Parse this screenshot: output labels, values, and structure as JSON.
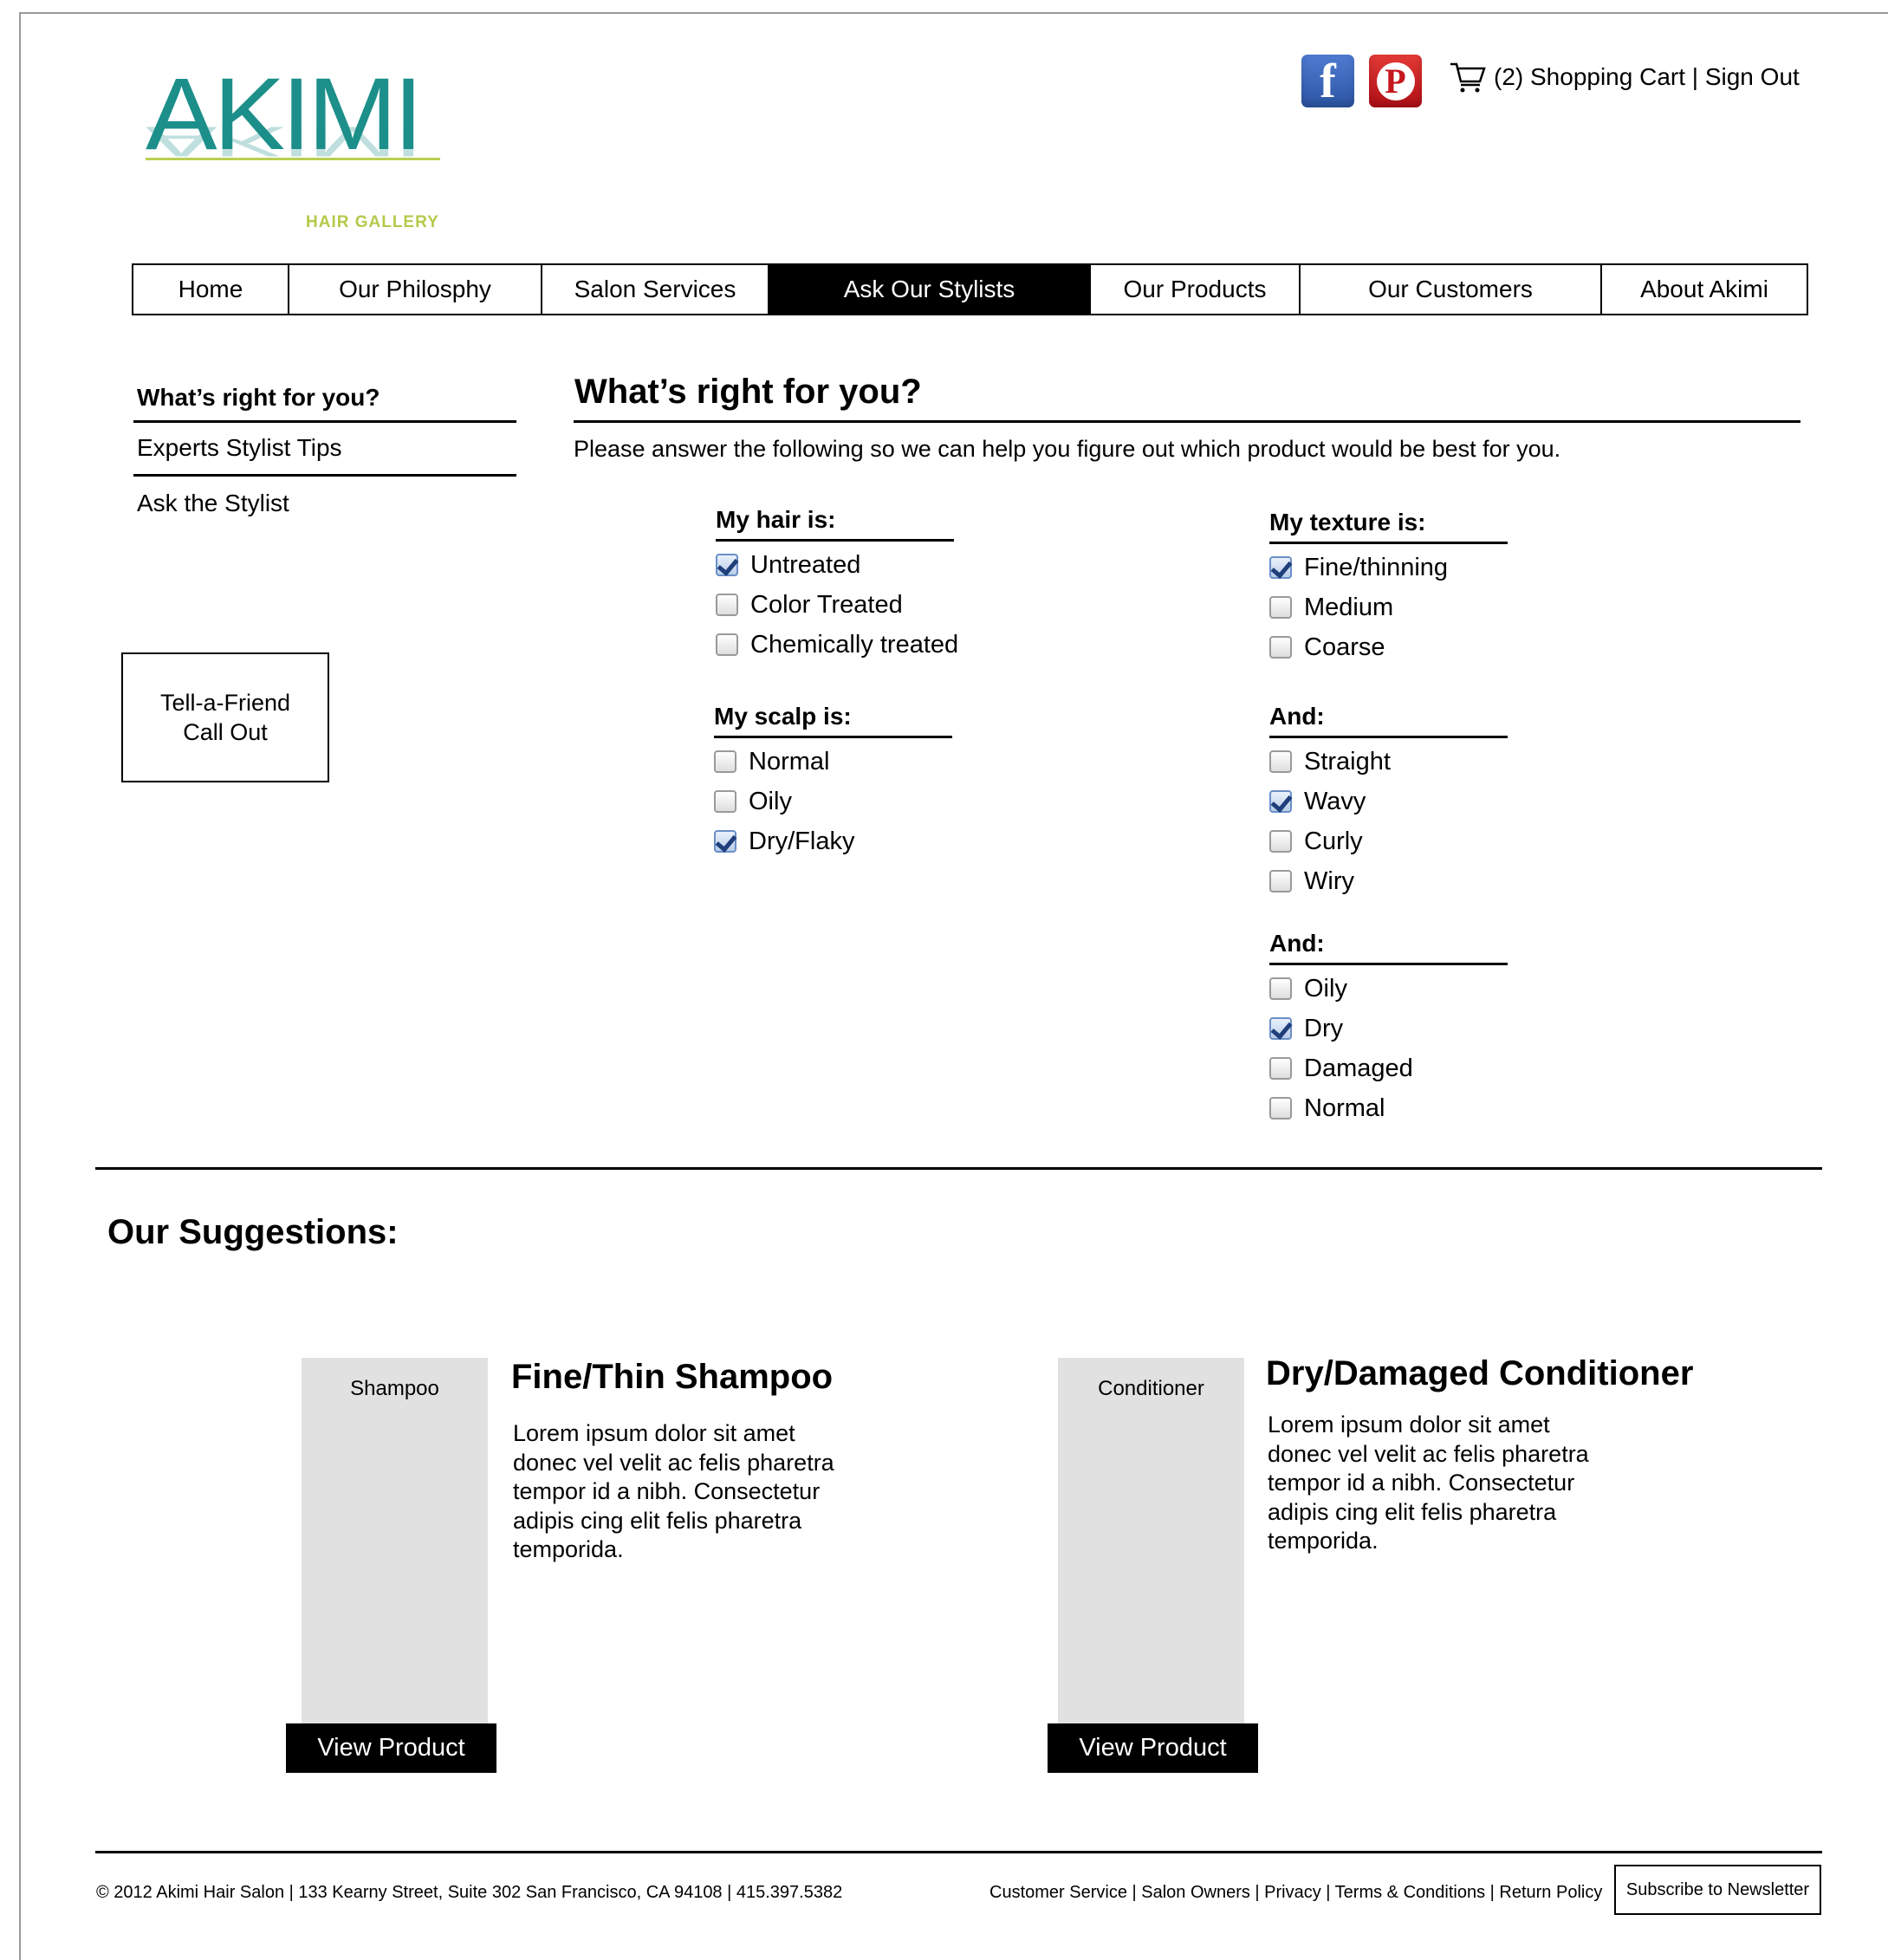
{
  "brand": {
    "logo_text": "AKIMI",
    "logo_sub": "HAIR GALLERY",
    "teal": "#1c8f8a",
    "lime": "#b9cf53"
  },
  "header": {
    "social": [
      {
        "name": "facebook-icon",
        "glyph": "f"
      },
      {
        "name": "pinterest-icon",
        "glyph": "P"
      }
    ],
    "cart_label": "(2) Shopping Cart | Sign Out"
  },
  "nav": [
    {
      "label": "Home",
      "active": false
    },
    {
      "label": "Our Philosphy",
      "active": false
    },
    {
      "label": "Salon Services",
      "active": false
    },
    {
      "label": "Ask Our Stylists",
      "active": true
    },
    {
      "label": "Our Products",
      "active": false
    },
    {
      "label": "Our Customers",
      "active": false
    },
    {
      "label": "About Akimi",
      "active": false
    }
  ],
  "sidebar": {
    "items": [
      "What’s right for you?",
      "Experts Stylist Tips",
      "Ask the Stylist"
    ],
    "callout": [
      "Tell-a-Friend",
      "Call Out"
    ]
  },
  "main": {
    "title": "What’s right for you?",
    "intro": "Please answer the following so we can help you figure out which product would be best for you.",
    "groups": {
      "hair": {
        "title": "My hair is:",
        "options": [
          {
            "label": "Untreated",
            "checked": true
          },
          {
            "label": "Color Treated",
            "checked": false
          },
          {
            "label": "Chemically treated",
            "checked": false
          }
        ]
      },
      "scalp": {
        "title": "My scalp is:",
        "options": [
          {
            "label": "Normal",
            "checked": false
          },
          {
            "label": "Oily",
            "checked": false
          },
          {
            "label": "Dry/Flaky",
            "checked": true
          }
        ]
      },
      "texture": {
        "title": "My texture is:",
        "options": [
          {
            "label": "Fine/thinning",
            "checked": true
          },
          {
            "label": "Medium",
            "checked": false
          },
          {
            "label": "Coarse",
            "checked": false
          }
        ]
      },
      "shape": {
        "title": "And:",
        "options": [
          {
            "label": "Straight",
            "checked": false
          },
          {
            "label": "Wavy",
            "checked": true
          },
          {
            "label": "Curly",
            "checked": false
          },
          {
            "label": "Wiry",
            "checked": false
          }
        ]
      },
      "condition": {
        "title": "And:",
        "options": [
          {
            "label": "Oily",
            "checked": false
          },
          {
            "label": "Dry",
            "checked": true
          },
          {
            "label": "Damaged",
            "checked": false
          },
          {
            "label": "Normal",
            "checked": false
          }
        ]
      }
    }
  },
  "suggestions": {
    "title": "Our Suggestions:",
    "products": [
      {
        "image_label": "Shampoo",
        "title": "Fine/Thin Shampoo",
        "desc_lines": [
          "Lorem ipsum dolor sit amet",
          "donec vel velit ac felis pharetra",
          "tempor id a nibh. Consectetur",
          "adipis cing elit felis pharetra",
          "temporida."
        ],
        "button": "View Product"
      },
      {
        "image_label": "Conditioner",
        "title": "Dry/Damaged Conditioner",
        "desc_lines": [
          "Lorem ipsum dolor sit amet",
          "donec vel velit ac felis pharetra",
          "tempor id a nibh. Consectetur",
          "adipis cing elit felis pharetra",
          "temporida."
        ],
        "button": "View Product"
      }
    ]
  },
  "footer": {
    "copyright": "© 2012 Akimi Hair Salon | 133 Kearny Street, Suite 302 San Francisco, CA 94108 | 415.397.5382",
    "links": "Customer Service | Salon Owners | Privacy | Terms & Conditions | Return Policy",
    "newsletter": "Subscribe to Newsletter"
  }
}
